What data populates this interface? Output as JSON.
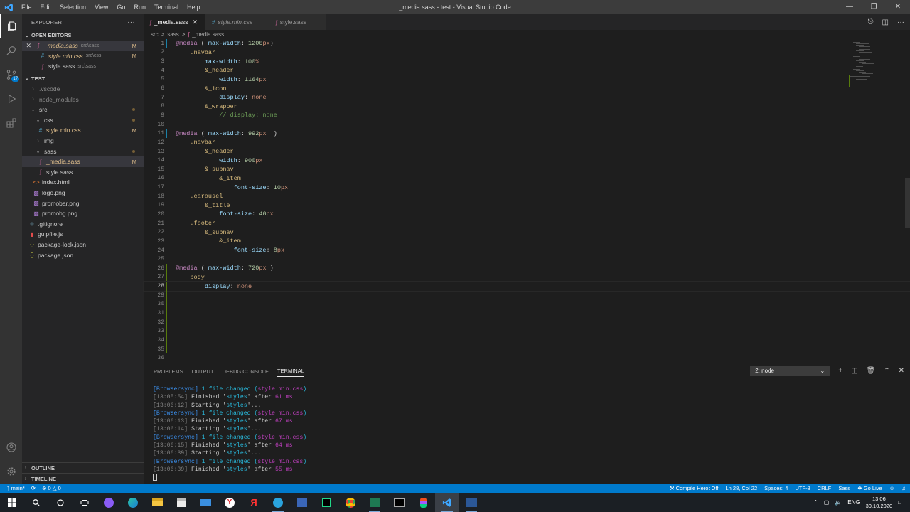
{
  "window": {
    "title": "_media.sass - test - Visual Studio Code",
    "menu": [
      "File",
      "Edit",
      "Selection",
      "View",
      "Go",
      "Run",
      "Terminal",
      "Help"
    ]
  },
  "activity": {
    "scm_badge": "17"
  },
  "sidebar": {
    "title": "EXPLORER",
    "more": "···",
    "open_editors": {
      "label": "OPEN EDITORS",
      "items": [
        {
          "name": "_media.sass",
          "path": "src\\sass",
          "status": "M"
        },
        {
          "name": "style.min.css",
          "path": "src\\css",
          "status": "M"
        },
        {
          "name": "style.sass",
          "path": "src\\sass",
          "status": ""
        }
      ]
    },
    "workspace": {
      "label": "TEST",
      "items": [
        {
          "name": ".vscode",
          "icon": "chevron-right-icon"
        },
        {
          "name": "node_modules",
          "icon": "chevron-right-icon"
        },
        {
          "name": "src",
          "icon": "chevron-down-icon"
        },
        {
          "name": "css",
          "icon": "chevron-down-icon"
        },
        {
          "name": "style.min.css",
          "status": "M"
        },
        {
          "name": "img",
          "icon": "chevron-right-icon"
        },
        {
          "name": "sass",
          "icon": "chevron-down-icon"
        },
        {
          "name": "_media.sass",
          "status": "M"
        },
        {
          "name": "style.sass"
        },
        {
          "name": "index.html"
        },
        {
          "name": "logo.png"
        },
        {
          "name": "promobar.png"
        },
        {
          "name": "promobg.png"
        },
        {
          "name": ".gitignore"
        },
        {
          "name": "gulpfile.js"
        },
        {
          "name": "package-lock.json"
        },
        {
          "name": "package.json"
        }
      ]
    },
    "outline": "OUTLINE",
    "timeline": "TIMELINE"
  },
  "editor": {
    "tabs": [
      "_media.sass",
      "style.min.css",
      "style.sass"
    ],
    "breadcrumb": [
      "src",
      ">",
      "sass",
      ">",
      "_media.sass"
    ],
    "line_numbers": [
      "1",
      "2",
      "3",
      "4",
      "5",
      "6",
      "7",
      "8",
      "9",
      "10",
      "11",
      "12",
      "13",
      "14",
      "15",
      "16",
      "17",
      "18",
      "19",
      "20",
      "21",
      "22",
      "23",
      "24",
      "25",
      "26",
      "27",
      "28",
      "29",
      "30",
      "31",
      "32",
      "33",
      "34",
      "35",
      "36"
    ],
    "code": {
      "at_media": "@media",
      "open_paren": " ( ",
      "max_width": "max-width",
      "colon": ": ",
      "v1200": "1200",
      "px": "px",
      "close_paren": ")",
      "close_sp": " )",
      "close_2sp": "  )",
      "navbar": ".navbar",
      "v100": "100",
      "pct": "%",
      "header": "&_header",
      "width": "width",
      "v1164": "1164",
      "icon": "&_icon",
      "display": "display",
      "none": "none",
      "wrapper": "&_wrapper",
      "comment": "// display: none",
      "v992": "992",
      "v900": "900",
      "subnav": "&_subnav",
      "item": "&_item",
      "font_size": "font-size",
      "v10": "10",
      "carousel": ".carousel",
      "title": "&_title",
      "v40": "40",
      "footer": ".footer",
      "v8": "8",
      "v720": "720",
      "body": "body"
    }
  },
  "panel": {
    "tabs": [
      "PROBLEMS",
      "OUTPUT",
      "DEBUG CONSOLE",
      "TERMINAL"
    ],
    "terminal_select": "2: node",
    "lines": [
      {
        "kind": "change",
        "tag": "[Browsersync]",
        "text": " 1 file changed (",
        "file": "style.min.css",
        "end": ")"
      },
      {
        "kind": "finish",
        "time": "[13:05:54]",
        "a": " Finished '",
        "task": "styles",
        "b": "' after ",
        "ms": "61 ms"
      },
      {
        "kind": "start",
        "time": "[13:06:12]",
        "a": " Starting '",
        "task": "styles",
        "b": "'..."
      },
      {
        "kind": "change",
        "tag": "[Browsersync]",
        "text": " 1 file changed (",
        "file": "style.min.css",
        "end": ")"
      },
      {
        "kind": "finish",
        "time": "[13:06:13]",
        "a": " Finished '",
        "task": "styles",
        "b": "' after ",
        "ms": "67 ms"
      },
      {
        "kind": "start",
        "time": "[13:06:14]",
        "a": " Starting '",
        "task": "styles",
        "b": "'..."
      },
      {
        "kind": "change",
        "tag": "[Browsersync]",
        "text": " 1 file changed (",
        "file": "style.min.css",
        "end": ")"
      },
      {
        "kind": "finish",
        "time": "[13:06:15]",
        "a": " Finished '",
        "task": "styles",
        "b": "' after ",
        "ms": "64 ms"
      },
      {
        "kind": "start",
        "time": "[13:06:39]",
        "a": " Starting '",
        "task": "styles",
        "b": "'..."
      },
      {
        "kind": "change",
        "tag": "[Browsersync]",
        "text": " 1 file changed (",
        "file": "style.min.css",
        "end": ")"
      },
      {
        "kind": "finish",
        "time": "[13:06:39]",
        "a": " Finished '",
        "task": "styles",
        "b": "' after ",
        "ms": "55 ms"
      }
    ]
  },
  "status": {
    "branch": "main*",
    "errors": "0",
    "warnings": "0",
    "compile_hero": "Compile Hero: Off",
    "position": "Ln 28, Col 22",
    "spaces": "Spaces: 4",
    "encoding": "UTF-8",
    "eol": "CRLF",
    "language": "Sass",
    "golive": "Go Live"
  },
  "taskbar": {
    "lang": "ENG",
    "time": "13:06",
    "date": "30.10.2020"
  },
  "colors": {
    "accent": "#007acc",
    "titlebar": "#3c3c3c",
    "sidebar": "#252526",
    "editor": "#1e1e1e",
    "modified": "#e2c08d"
  }
}
